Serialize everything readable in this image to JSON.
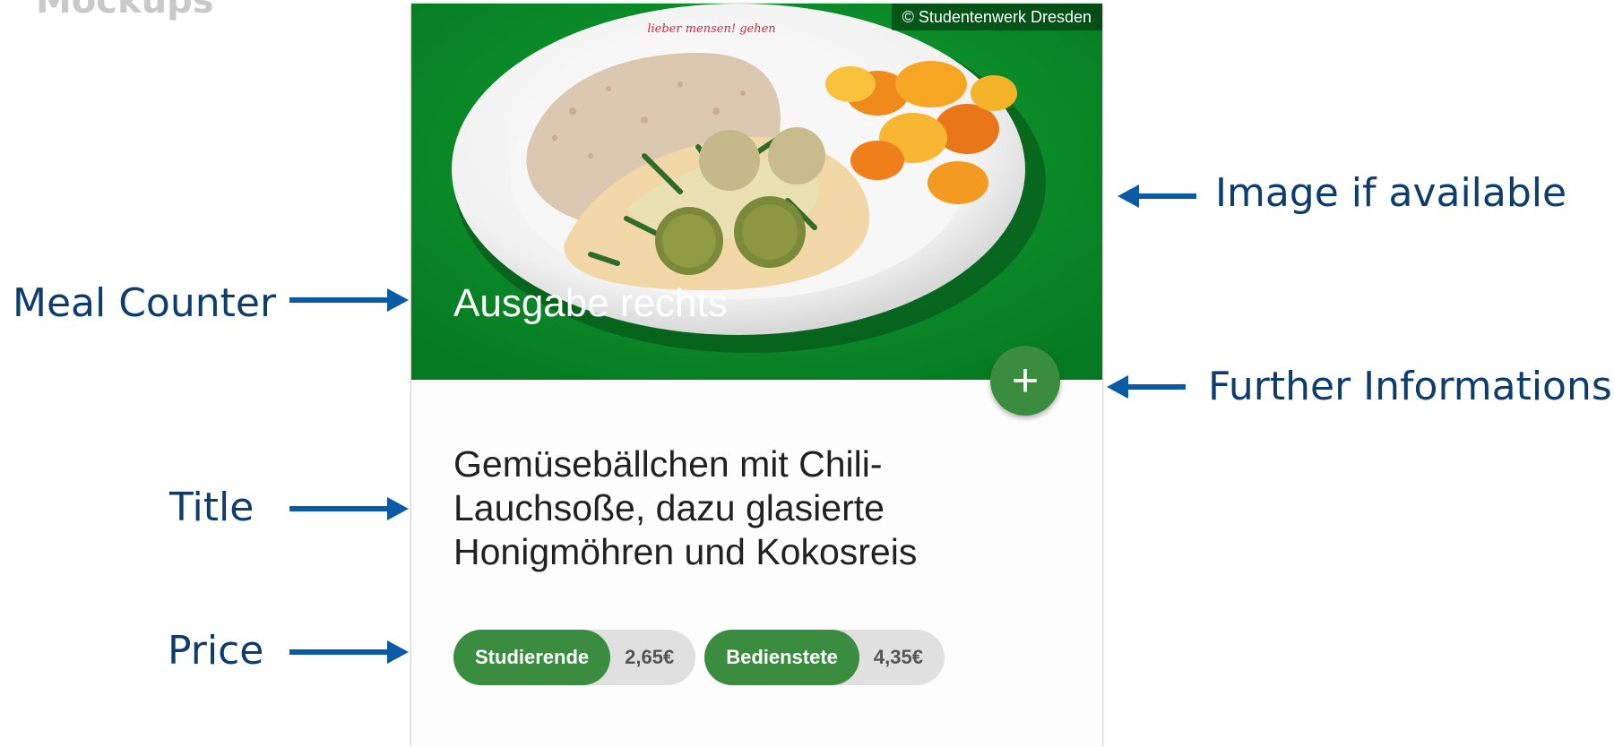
{
  "heading": "Mockups",
  "card": {
    "image_credit": "© Studentenwerk Dresden",
    "plate_logo_text": "lieber mensen! gehen",
    "meal_counter": "Ausgabe rechts",
    "more_button_icon": "plus-icon",
    "more_button_glyph": "+",
    "title_lines": [
      "Gemüsebällchen mit Chili-",
      "Lauchsoße, dazu glasierte",
      "Honigmöhren und Kokosreis"
    ],
    "prices": [
      {
        "label": "Studierende",
        "value": "2,65€"
      },
      {
        "label": "Bedienstete",
        "value": "4,35€"
      }
    ]
  },
  "annotations": {
    "image": "Image if available",
    "meal_counter": "Meal Counter",
    "further_info": "Further Informations",
    "title": "Title",
    "price": "Price"
  },
  "colors": {
    "image_background": "#0c8a2a",
    "accent_green": "#3a8d3e",
    "chip_grey": "#e0e0e0",
    "annotation_text": "#0d3c6e",
    "arrow": "#0b5aa6"
  }
}
